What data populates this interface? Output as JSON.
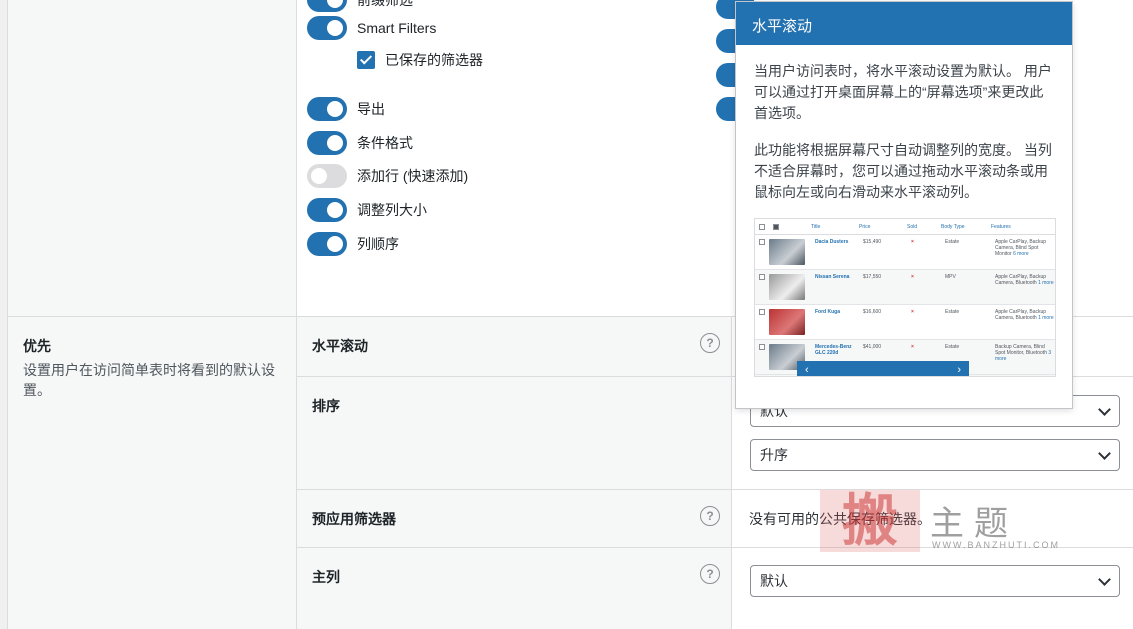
{
  "top_toggles": [
    {
      "label": "前缀筛选",
      "on": true
    },
    {
      "label": "Smart Filters",
      "on": true
    },
    {
      "label": "导出",
      "on": true
    },
    {
      "label": "条件格式",
      "on": true
    },
    {
      "label": "添加行 (快速添加)",
      "on": false
    },
    {
      "label": "调整列大小",
      "on": true
    },
    {
      "label": "列顺序",
      "on": true
    }
  ],
  "saved_filters_checkbox": {
    "label": "已保存的筛选器",
    "checked": true
  },
  "section": {
    "title": "优先",
    "description": "设置用户在访问简单表时将看到的默认设置。"
  },
  "rows": {
    "horizontal_scroll": {
      "label": "水平滚动"
    },
    "sorting": {
      "label": "排序",
      "select1": "默认",
      "select2": "升序"
    },
    "prefilter": {
      "label": "预应用筛选器",
      "value": "没有可用的公共保存筛选器。"
    },
    "primary_column": {
      "label": "主列",
      "select": "默认"
    }
  },
  "help_symbol": "?",
  "popover": {
    "title": "水平滚动",
    "para1": "当用户访问表时，将水平滚动设置为默认。 用户可以通过打开桌面屏幕上的“屏幕选项”来更改此首选项。",
    "para2": "此功能将根据屏幕尺寸自动调整列的宽度。 当列不适合屏幕时，您可以通过拖动水平滚动条或用鼠标向左或向右滑动来水平滚动列。",
    "preview": {
      "headers": [
        "Title",
        "Price",
        "Sold",
        "Body Type",
        "Features"
      ],
      "rows": [
        {
          "title": "Dacia Dusters",
          "price": "$15,490",
          "sold": "×",
          "body": "Estate",
          "features": "Apple CarPlay, Backup Camera, Blind Spot Monitor",
          "more": "6 more"
        },
        {
          "title": "Nissan Serena",
          "price": "$17,550",
          "sold": "×",
          "body": "MPV",
          "features": "Apple CarPlay, Backup Camera, Bluetooth",
          "more": "1 more"
        },
        {
          "title": "Ford Kuga",
          "price": "$16,600",
          "sold": "×",
          "body": "Estate",
          "features": "Apple CarPlay, Backup Camera, Bluetooth",
          "more": "1 more"
        },
        {
          "title": "Mercedes-Benz GLC 220d",
          "price": "$41,000",
          "sold": "×",
          "body": "Estate",
          "features": "Backup Camera, Blind Spot Monitor, Bluetooth",
          "more": "3 more"
        }
      ],
      "scroll_left": "‹",
      "scroll_right": "›"
    }
  },
  "watermark": {
    "stamp": "搬",
    "text": "主题",
    "url": "WWW.BANZHUTI.COM"
  }
}
